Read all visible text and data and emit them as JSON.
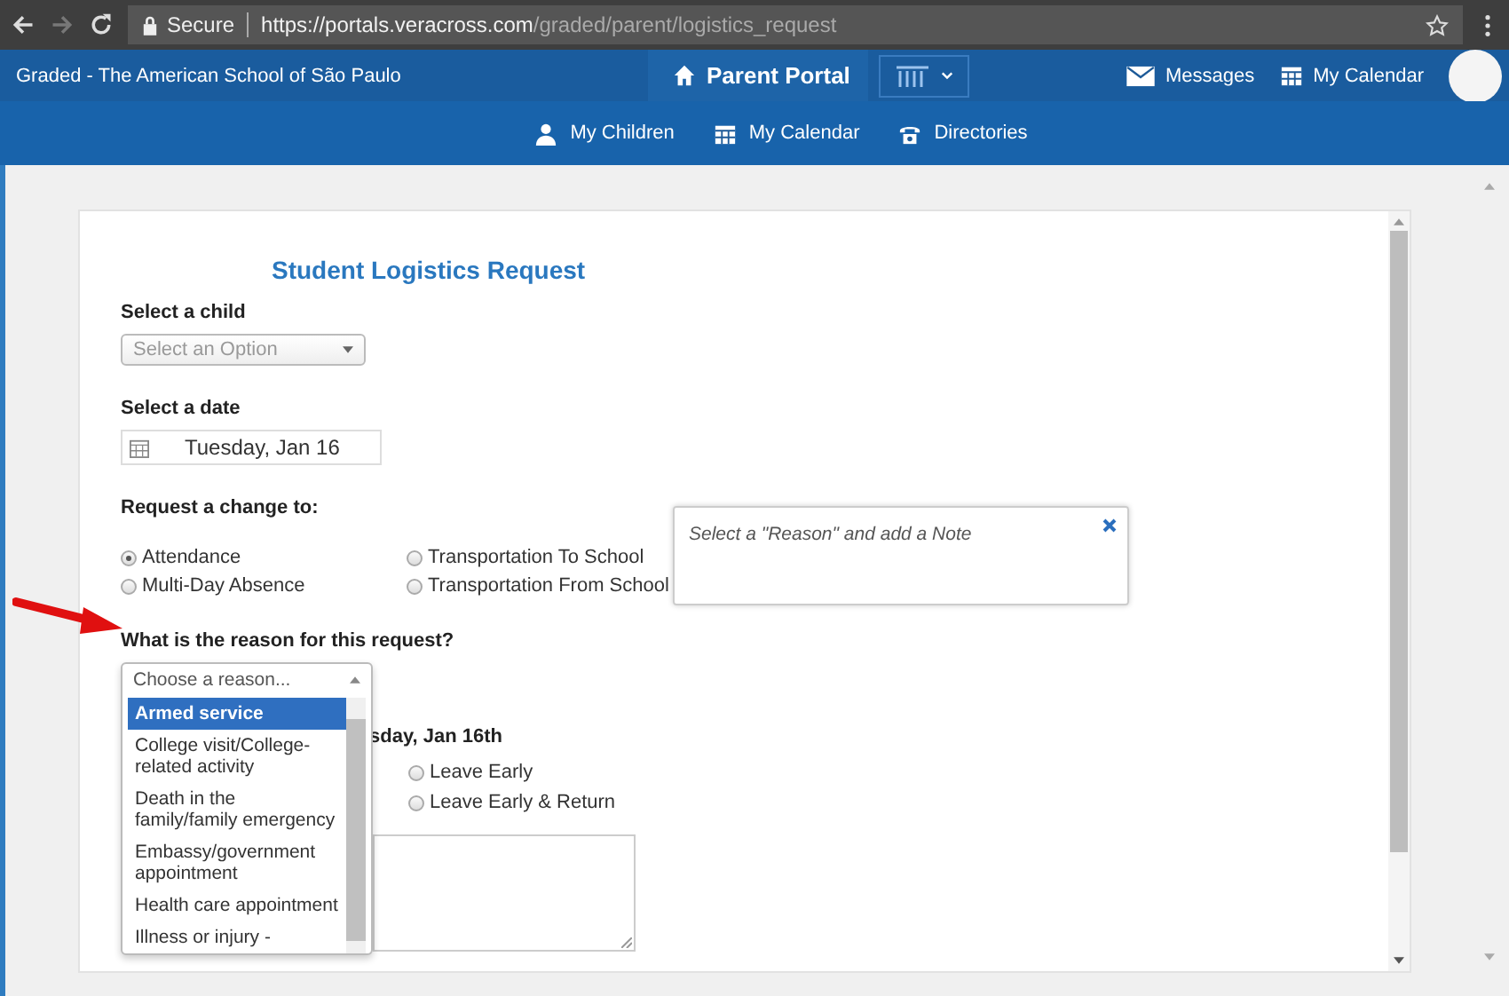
{
  "browser": {
    "secure_label": "Secure",
    "url_host": "https://portals.veracross.com",
    "url_path": "/graded/parent/logistics_request"
  },
  "top_nav": {
    "school": "Graded - The American School of São Paulo",
    "portal": "Parent Portal",
    "links": [
      {
        "label": "Messages"
      },
      {
        "label": "My Calendar"
      }
    ]
  },
  "sub_nav": [
    {
      "label": "My Children"
    },
    {
      "label": "My Calendar"
    },
    {
      "label": "Directories"
    }
  ],
  "form": {
    "title": "Student Logistics Request",
    "child_label": "Select a child",
    "child_select": {
      "placeholder": "Select an Option"
    },
    "date_label": "Select a date",
    "date_value": "Tuesday, Jan 16",
    "change_label": "Request a change to:",
    "change_options": [
      {
        "label": "Attendance",
        "selected": true
      },
      {
        "label": "Transportation To School",
        "selected": false
      },
      {
        "label": "Multi-Day Absence",
        "selected": false
      },
      {
        "label": "Transportation From School",
        "selected": false
      }
    ],
    "note_popover": "Select a \"Reason\" and add a Note",
    "reason_label": "What is the reason for this request?",
    "reason_select": {
      "placeholder": "Choose a reason..."
    },
    "reason_options": [
      {
        "label": "Armed service",
        "selected": true
      },
      {
        "label": "College visit/College-related activity",
        "selected": false
      },
      {
        "label": "Death in the family/family emergency",
        "selected": false
      },
      {
        "label": "Embassy/government appointment",
        "selected": false
      },
      {
        "label": "Health care appointment",
        "selected": false
      },
      {
        "label": "Illness or injury -",
        "selected": false
      }
    ],
    "time_heading": "sday, Jan 16th",
    "time_options": [
      {
        "label": "Leave Early",
        "selected": false
      },
      {
        "label": "Leave Early & Return",
        "selected": false
      }
    ]
  }
}
